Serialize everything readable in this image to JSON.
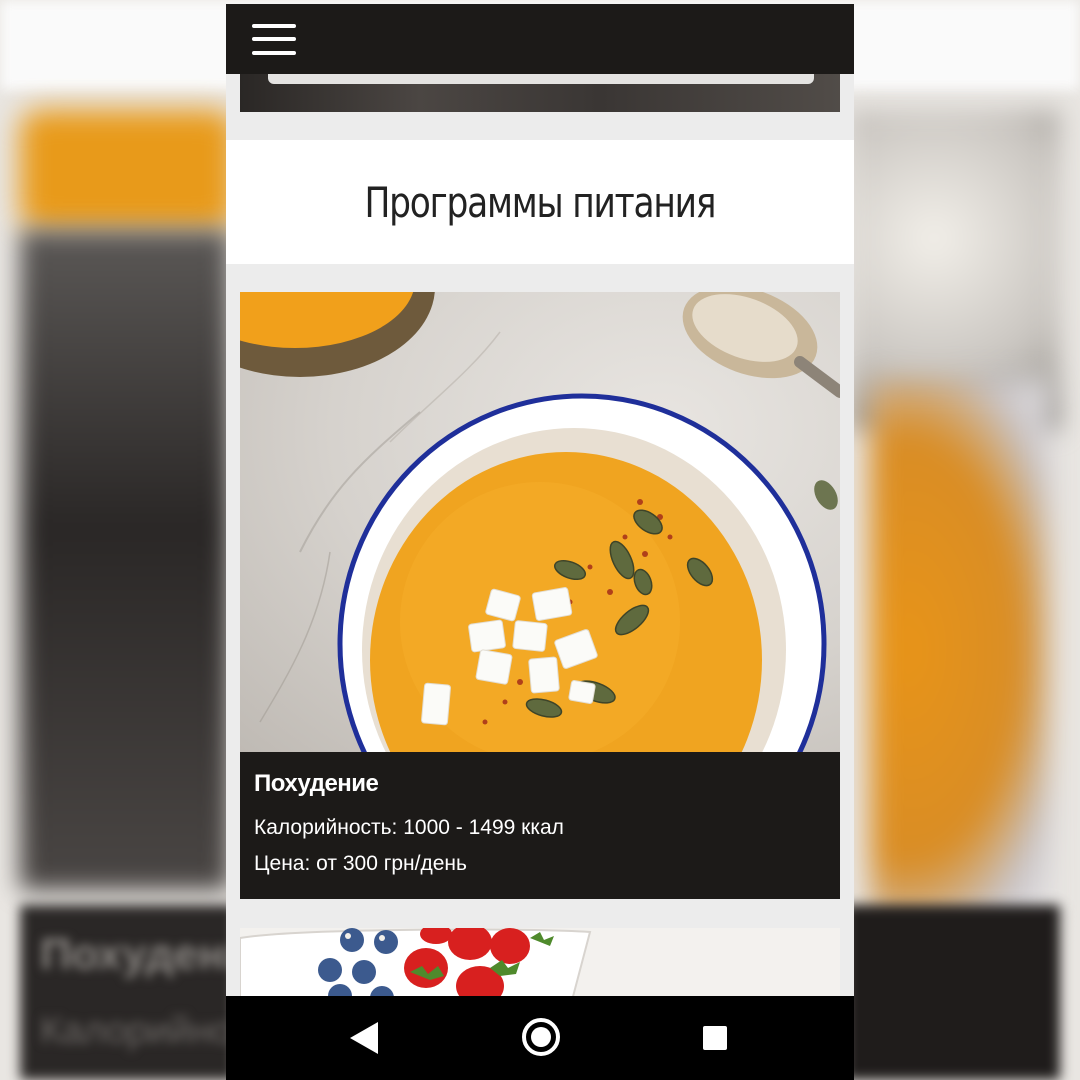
{
  "app": {
    "menu_icon": "hamburger-menu-icon"
  },
  "section": {
    "title": "Программы питания"
  },
  "program_card": {
    "image_icon": "pumpkin-soup-photo",
    "title": "Похудение",
    "calories": "Калорийность: 1000 - 1499 ккал",
    "price": "Цена: от 300 грн/день"
  },
  "next_card": {
    "image_icon": "berries-bowl-photo"
  },
  "system_nav": {
    "back_icon": "back-triangle-icon",
    "home_icon": "home-circle-icon",
    "recents_icon": "recents-square-icon"
  },
  "colors": {
    "header_bg": "#1c1a18",
    "card_info_bg": "#1c1a18",
    "soup_orange": "#f0a420",
    "bowl_rim_blue": "#1f2f9a",
    "page_bg": "#ececec"
  }
}
